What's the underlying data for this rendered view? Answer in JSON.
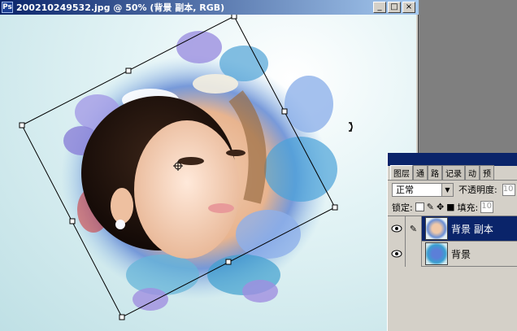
{
  "document": {
    "title": "200210249532.jpg @ 50% (背景 副本, RGB)",
    "window_buttons": [
      "_",
      "□",
      "×"
    ],
    "zoom": "50%",
    "color_mode": "RGB"
  },
  "layers_panel": {
    "tabs": [
      {
        "label": "图层",
        "active": true
      },
      {
        "label": "通"
      },
      {
        "label": "路"
      },
      {
        "label": "记录"
      },
      {
        "label": "动"
      },
      {
        "label": "预"
      }
    ],
    "blend_mode": "正常",
    "opacity_label": "不透明度:",
    "opacity_value": "10",
    "lock_label": "锁定:",
    "fill_label": "填充:",
    "fill_value": "10",
    "layers": [
      {
        "name": "背景 副本",
        "selected": true
      },
      {
        "name": "背景",
        "selected": false
      }
    ]
  },
  "colors": {
    "titlebar_start": "#0a246a",
    "titlebar_end": "#a6caf0",
    "selection": "#0a246a",
    "panel_bg": "#d4d0c8",
    "workspace": "#808080"
  }
}
